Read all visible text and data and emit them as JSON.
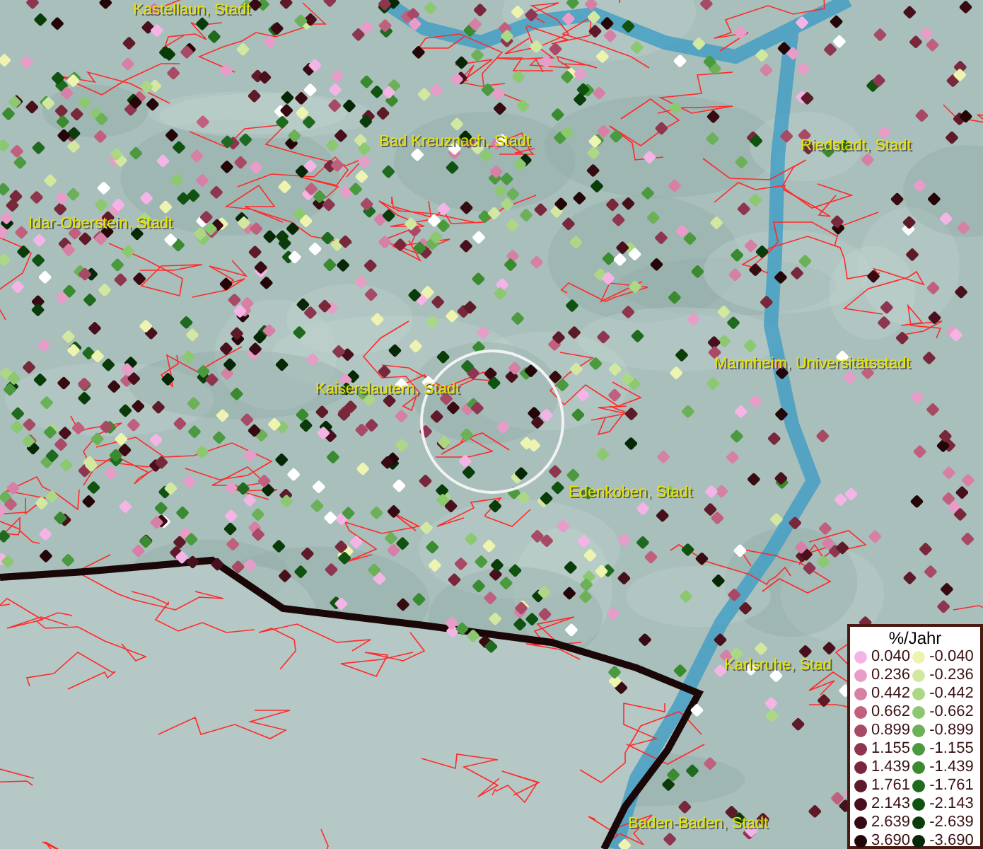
{
  "map": {
    "places": [
      {
        "name": "Kastellaun, Stadt"
      },
      {
        "name": "Bad Kreuznach, Stadt"
      },
      {
        "name": "Riedstadt, Stadt"
      },
      {
        "name": "Idar-Oberstein, Stadt"
      },
      {
        "name": "Mannheim, Universitätsstadt"
      },
      {
        "name": "Kaiserslautern, Stadt"
      },
      {
        "name": "Edenkoben, Stadt"
      },
      {
        "name": "Karlsruhe, Stad"
      },
      {
        "name": "Baden-Baden, Stadt"
      }
    ]
  },
  "legend": {
    "title": "%/Jahr",
    "classes": [
      {
        "positive": {
          "value": "0.040",
          "color": "#f4b4e6"
        },
        "negative": {
          "value": "-0.040",
          "color": "#eef4b0"
        }
      },
      {
        "positive": {
          "value": "0.236",
          "color": "#e89cc8"
        },
        "negative": {
          "value": "-0.236",
          "color": "#d2e8a0"
        }
      },
      {
        "positive": {
          "value": "0.442",
          "color": "#d680a6"
        },
        "negative": {
          "value": "-0.442",
          "color": "#acd886"
        }
      },
      {
        "positive": {
          "value": "0.662",
          "color": "#c0607e"
        },
        "negative": {
          "value": "-0.662",
          "color": "#8cc870"
        }
      },
      {
        "positive": {
          "value": "0.899",
          "color": "#a84a66"
        },
        "negative": {
          "value": "-0.899",
          "color": "#6cb058"
        }
      },
      {
        "positive": {
          "value": "1.155",
          "color": "#8e3650"
        },
        "negative": {
          "value": "-1.155",
          "color": "#4c9a40"
        }
      },
      {
        "positive": {
          "value": "1.439",
          "color": "#78283a"
        },
        "negative": {
          "value": "-1.439",
          "color": "#3a8a30"
        }
      },
      {
        "positive": {
          "value": "1.761",
          "color": "#5e1a28"
        },
        "negative": {
          "value": "-1.761",
          "color": "#206a20"
        }
      },
      {
        "positive": {
          "value": "2.143",
          "color": "#48101c"
        },
        "negative": {
          "value": "-2.143",
          "color": "#105210"
        }
      },
      {
        "positive": {
          "value": "2.639",
          "color": "#380a12"
        },
        "negative": {
          "value": "-2.639",
          "color": "#0a3c0a"
        }
      },
      {
        "positive": {
          "value": "3.690",
          "color": "#240508"
        },
        "negative": {
          "value": "-3.690",
          "color": "#062806"
        }
      }
    ]
  }
}
